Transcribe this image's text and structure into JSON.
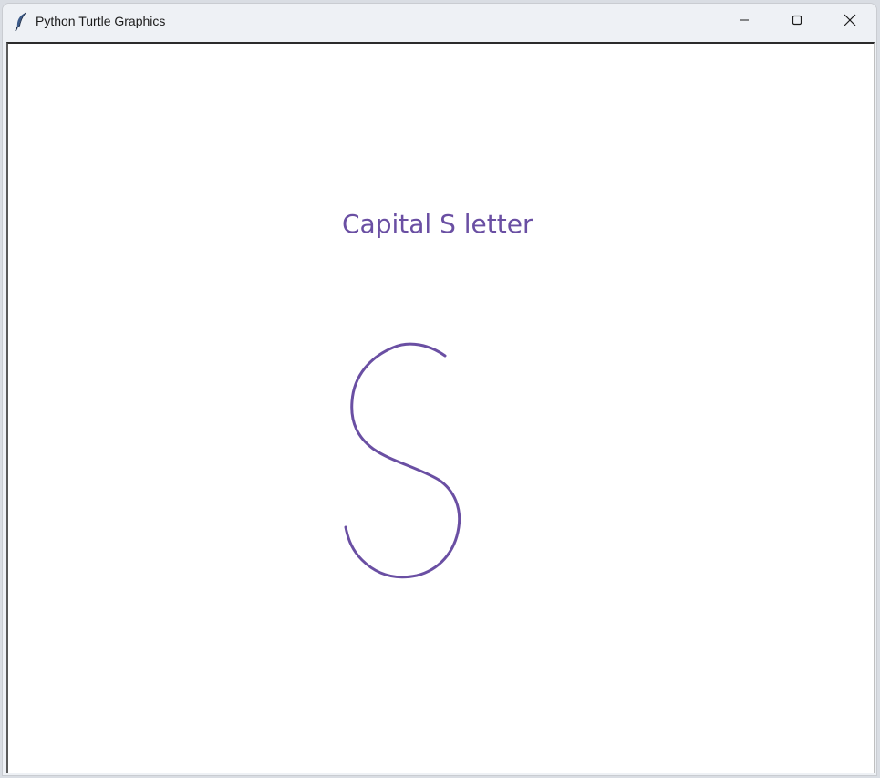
{
  "window": {
    "title": "Python Turtle Graphics",
    "icon": "feather-icon",
    "controls": {
      "minimize_icon": "minimize-icon",
      "maximize_icon": "maximize-icon",
      "close_icon": "close-icon"
    }
  },
  "canvas": {
    "label": "Capital S letter",
    "pen_color": "#6a4fa3",
    "background_color": "#ffffff"
  }
}
